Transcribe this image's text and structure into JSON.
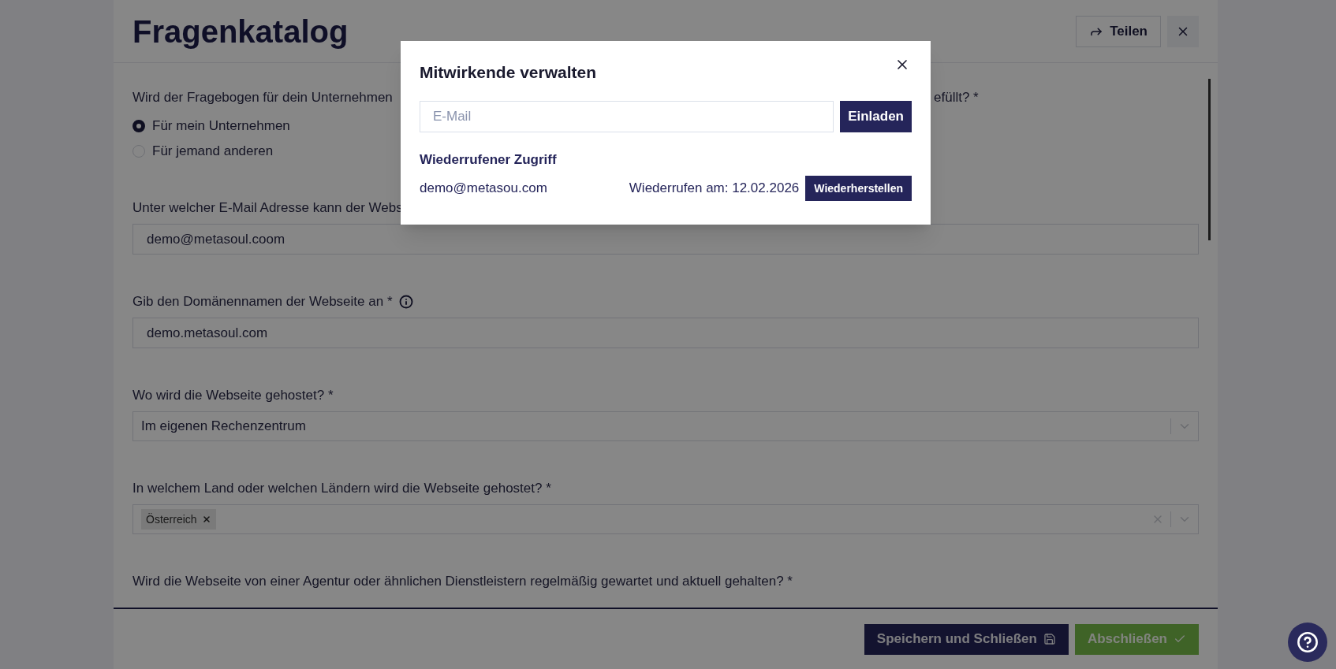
{
  "header": {
    "title": "Fragenkatalog",
    "share_button": "Teilen"
  },
  "questions": [
    {
      "kind": "radio",
      "label_start": "Wird der Fragebogen für dein Unternehmen",
      "label_end": "efüllt? *",
      "options": [
        {
          "label": "Für mein Unternehmen",
          "selected": true
        },
        {
          "label": "Für jemand anderen",
          "selected": false
        }
      ]
    },
    {
      "kind": "text",
      "label": "Unter welcher E-Mail Adresse kann der Webs",
      "value": "demo@metasoul.coom"
    },
    {
      "kind": "text",
      "label": "Gib den Domänennamen der Webseite an *",
      "info": true,
      "value": "demo.metasoul.com"
    },
    {
      "kind": "select",
      "label": "Wo wird die Webseite gehostet? *",
      "value": "Im eigenen Rechenzentrum"
    },
    {
      "kind": "multiselect",
      "label": "In welchem Land oder welchen Ländern wird die Webseite gehostet? *",
      "tags": [
        "Österreich"
      ]
    },
    {
      "kind": "label",
      "label": "Wird die Webseite von einer Agentur oder ähnlichen Dienstleistern regelmäßig gewartet und aktuell gehalten? *"
    }
  ],
  "footer": {
    "save_button": "Speichern und Schließen",
    "finish_button": "Abschließen"
  },
  "dialog": {
    "title": "Mitwirkende verwalten",
    "email_field": {
      "placeholder": "E-Mail"
    },
    "invite_button": "Einladen",
    "section_title": "Wiederrufener Zugriff",
    "revoked": [
      {
        "email": "demo@metasou.com",
        "revoked_text": "Wiederrufen am: 12.02.2026",
        "restore_button": "Wiederherstellen"
      }
    ]
  }
}
